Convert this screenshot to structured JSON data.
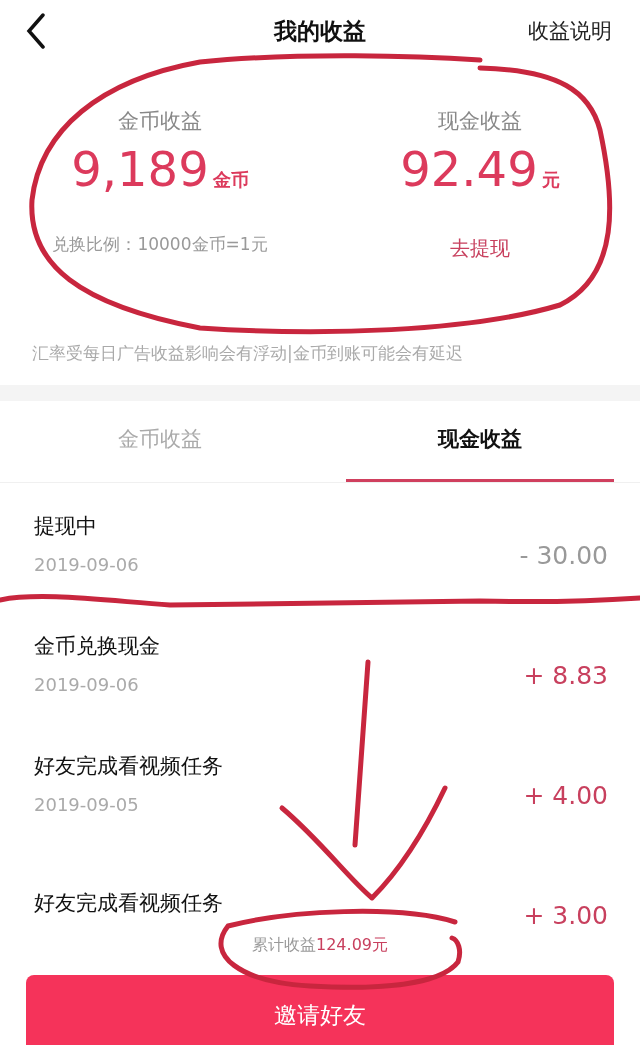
{
  "header": {
    "title": "我的收益",
    "action": "收益说明"
  },
  "summary": [
    {
      "label": "金币收益",
      "value": "9,189",
      "unit": "金币",
      "note": "兑换比例：10000金币=1元",
      "kind": "note"
    },
    {
      "label": "现金收益",
      "value": "92.49",
      "unit": "元",
      "note": "去提现",
      "kind": "link"
    }
  ],
  "disclaimer": "汇率受每日广告收益影响会有浮动|金币到账可能会有延迟",
  "tabs": [
    {
      "label": "金币收益",
      "selected": false
    },
    {
      "label": "现金收益",
      "selected": true
    }
  ],
  "records": [
    {
      "title": "提现中",
      "date": "2019-09-06",
      "amount": "- 30.00",
      "kind": "out"
    },
    {
      "title": "金币兑换现金",
      "date": "2019-09-06",
      "amount": "+ 8.83",
      "kind": "in"
    },
    {
      "title": "好友完成看视频任务",
      "date": "2019-09-05",
      "amount": "+ 4.00",
      "kind": "in"
    },
    {
      "title": "好友完成看视频任务",
      "amount": "+ 3.00",
      "kind": "in"
    }
  ],
  "total": {
    "label": "累计收益",
    "amount": "124.09元"
  },
  "button": "邀请好友"
}
